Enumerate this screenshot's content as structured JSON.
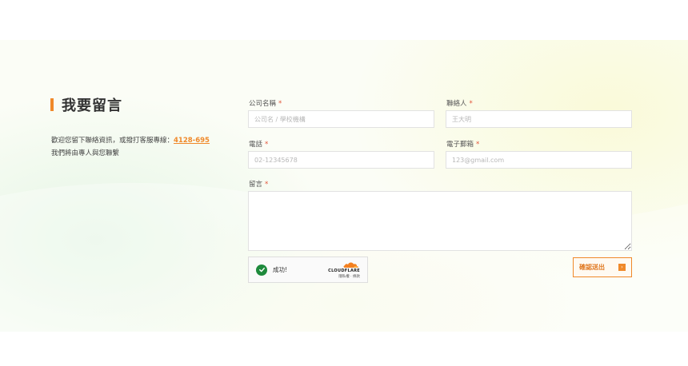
{
  "section": {
    "title": "我要留言",
    "intro_line1": "歡迎您留下聯絡資訊，或撥打客服專線：",
    "phone": "4128-695",
    "intro_line2": "我們將由專人與您聯繫"
  },
  "form": {
    "company": {
      "label": "公司名稱",
      "placeholder": "公司名 / 學校機構"
    },
    "contact": {
      "label": "聯絡人",
      "placeholder": "王大明"
    },
    "phone": {
      "label": "電話",
      "placeholder": "02-12345678"
    },
    "email": {
      "label": "電子郵箱",
      "placeholder": "123@gmail.com"
    },
    "message": {
      "label": "留言",
      "placeholder": ""
    },
    "required_mark": "*",
    "submit_label": "確認送出",
    "submit_arrow": "›"
  },
  "captcha": {
    "status": "成功!",
    "brand": "CLOUDFLARE",
    "links": "隱私權 · 條款"
  },
  "colors": {
    "accent": "#f0892a",
    "required": "#e2553a",
    "success": "#1e8a3c"
  }
}
